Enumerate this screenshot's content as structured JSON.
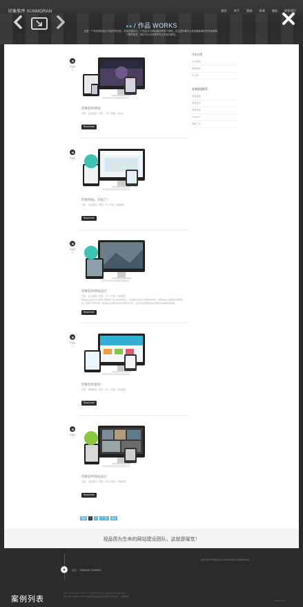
{
  "header": {
    "logo": "印象软件 XUNMORAN",
    "nav": [
      "首页",
      "关于",
      "案例",
      "新闻",
      "服务",
      "联系我们"
    ],
    "title_icon": "chat-bubbles-icon",
    "title": "/ 作品 WORKS",
    "description": "这里一个有关网站设计与制作的作品，包括页面设计、产品设计与网站建设等多个领域，在这里你都可以找到最新最好的作品案例，只要你愿意，我们可以为你提供专业的设计服务。"
  },
  "posts": [
    {
      "month": "FEB",
      "day": "24",
      "title": "印象软件网站",
      "meta": "分类：企业网站 | 浏览：170 | 作者：admin",
      "excerpt": "",
      "read_more": "Read more"
    },
    {
      "month": "FEB",
      "day": "27",
      "title": "印象网站，开始了！",
      "meta": "分类：企业网站 | 浏览：75 | 作者：印象软件",
      "excerpt": "",
      "read_more": "Read more"
    },
    {
      "month": "FEB",
      "day": "24",
      "title": "印象软件网站设计",
      "meta": "分类：企业网站 | 浏览：197 | 作者：印象软件",
      "excerpt": "网站设计是建立在对客户需求和行业分析的基础上，通过精心的设计和独特的创意，使网站在众多网站中脱颖而出，给客户带来价值。网站的设计要符合用户的使用习惯，让用户在浏览网站的过程中获得愉快的体验。",
      "read_more": "Read more"
    },
    {
      "month": "FEB",
      "day": "25",
      "title": "印象软件案例",
      "meta": "分类：电商网站 | 浏览：181 | 作者：印象软件",
      "excerpt": "",
      "read_more": "Read more"
    },
    {
      "month": "FEB",
      "day": "24",
      "title": "印象软件网站设计",
      "meta": "分类：企业网站 | 浏览：165 | 作者：印象软件",
      "excerpt": "",
      "read_more": "Read more"
    }
  ],
  "sidebar": {
    "categories_title": "作品分类",
    "categories": [
      "企业网站",
      "电商网站",
      "CI 设计"
    ],
    "tags_title": "友情链接推荐",
    "tags": [
      "网站建设",
      "网站设计",
      "网站优化",
      "Shopeon",
      "网络工作"
    ]
  },
  "pagination": [
    "首页",
    "1",
    "2",
    "下一页",
    "末页"
  ],
  "slogan": "视品质为生命的网站建设团队，这就是璀觉！",
  "footer": {
    "links": "OUR HAPPENINGS  |  XUNMORAN  |  XUNMORAN",
    "qq_icon": "qq-icon",
    "qq": "QQ：7986858 7986858",
    "copyright": "2003-2015 COPYRIGHT © XUNMORAN ALL RIGHTS RESERVED",
    "icp": "苏ICP备: 12345678号 印象软件网站建设 版权所有 技术支持：印象软件",
    "caption": "案例列表",
    "page_info": "1/15 1 2 3 4"
  },
  "colors": {
    "accent": "#5bb6d6",
    "header_bg": "#2c2d2e",
    "footer_bg": "#2b2b2b",
    "button": "#2c2c2c"
  }
}
